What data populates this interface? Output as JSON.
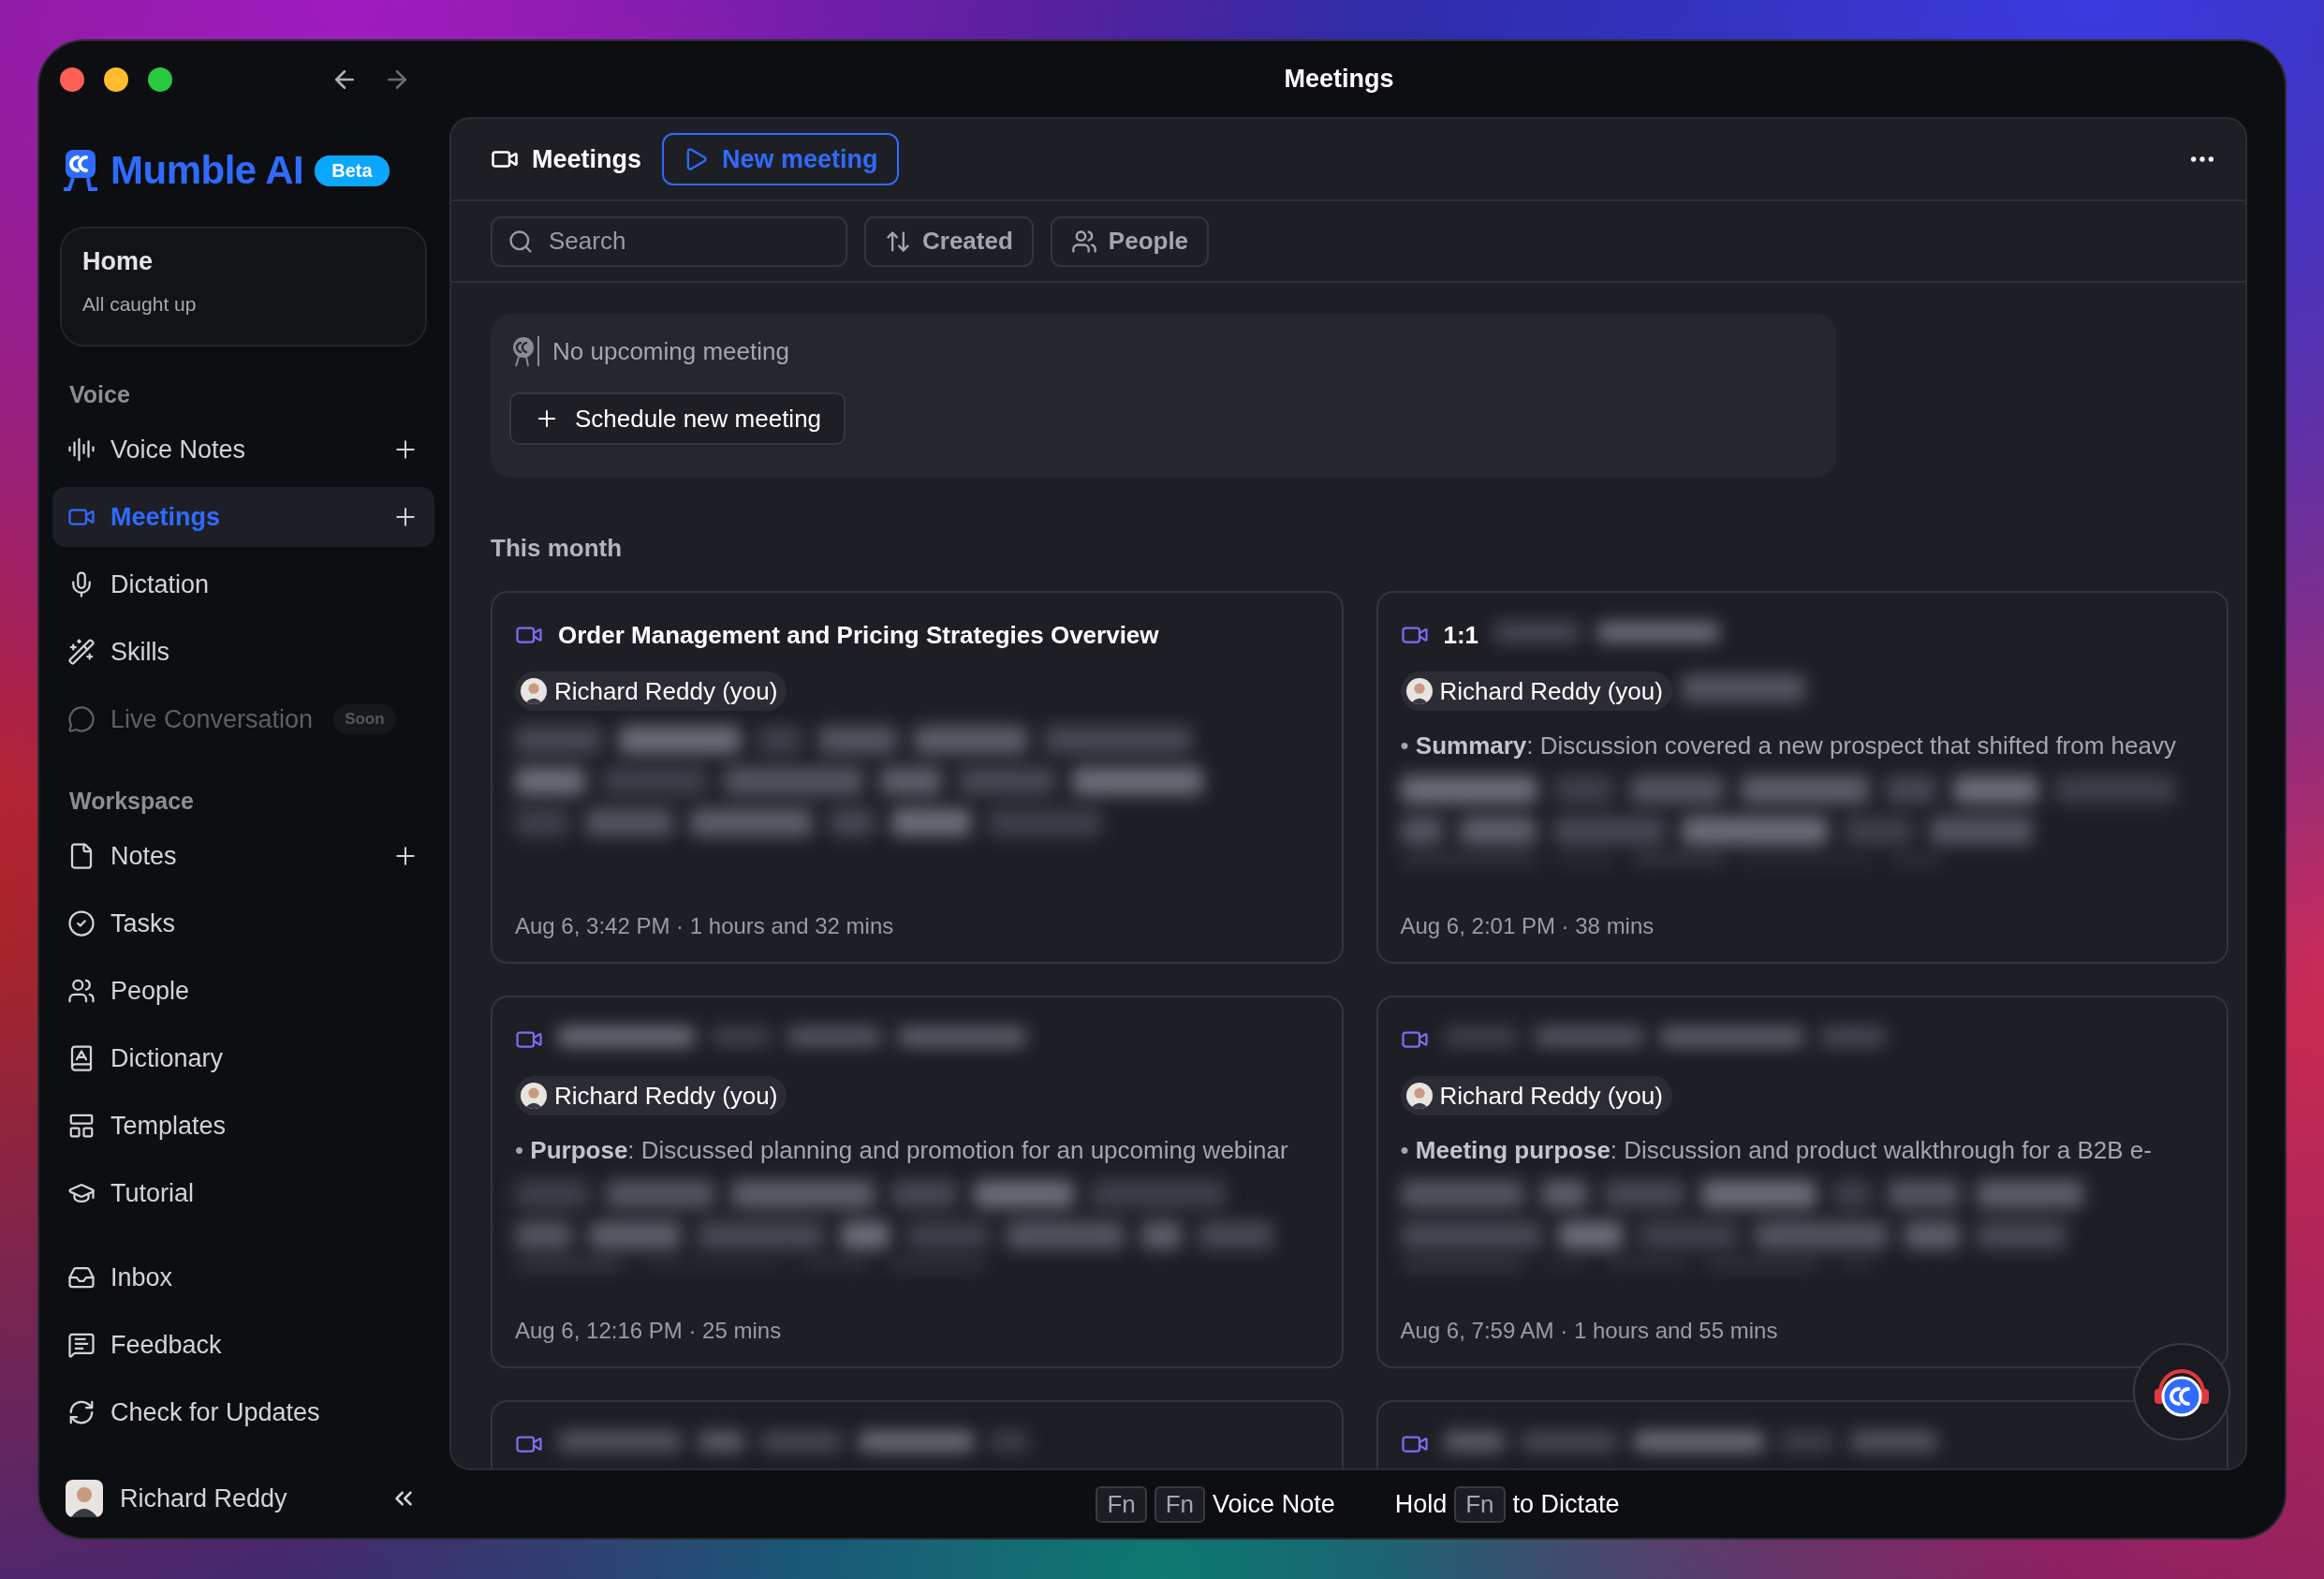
{
  "window": {
    "title": "Meetings"
  },
  "brand": {
    "name": "Mumble AI",
    "badge": "Beta"
  },
  "home_card": {
    "title": "Home",
    "subtitle": "All caught up"
  },
  "sidebar": {
    "sections": [
      {
        "heading": "Voice",
        "items": [
          {
            "label": "Voice Notes",
            "selected": false,
            "disabled": false,
            "add": true
          },
          {
            "label": "Meetings",
            "selected": true,
            "disabled": false,
            "add": true
          },
          {
            "label": "Dictation",
            "selected": false,
            "disabled": false,
            "add": false
          },
          {
            "label": "Skills",
            "selected": false,
            "disabled": false,
            "add": false
          },
          {
            "label": "Live Conversation",
            "selected": false,
            "disabled": true,
            "add": false,
            "badge": "Soon"
          }
        ]
      },
      {
        "heading": "Workspace",
        "items": [
          {
            "label": "Notes",
            "selected": false,
            "disabled": false,
            "add": true
          },
          {
            "label": "Tasks",
            "selected": false,
            "disabled": false,
            "add": false
          },
          {
            "label": "People",
            "selected": false,
            "disabled": false,
            "add": false
          },
          {
            "label": "Dictionary",
            "selected": false,
            "disabled": false,
            "add": false
          },
          {
            "label": "Templates",
            "selected": false,
            "disabled": false,
            "add": false
          },
          {
            "label": "Tutorial",
            "selected": false,
            "disabled": false,
            "add": false
          }
        ]
      },
      {
        "items": [
          {
            "label": "Inbox",
            "selected": false,
            "disabled": false,
            "add": false
          },
          {
            "label": "Feedback",
            "selected": false,
            "disabled": false,
            "add": false
          },
          {
            "label": "Check for Updates",
            "selected": false,
            "disabled": false,
            "add": false
          }
        ]
      }
    ]
  },
  "user": {
    "name": "Richard Reddy"
  },
  "header": {
    "title": "Meetings",
    "new_button": "New meeting"
  },
  "filters": {
    "search_placeholder": "Search",
    "sort": "Created",
    "people": "People"
  },
  "upcoming": {
    "message": "No upcoming meeting",
    "button": "Schedule new meeting"
  },
  "section_heading": "This month",
  "meetings": [
    {
      "title": "Order Management and Pricing Strategies Overview",
      "attendee": "Richard Reddy (you)",
      "body_redacted": true,
      "meta": "Aug 6, 3:42 PM · 1 hours and 32 mins"
    },
    {
      "title": "1:1",
      "title_redacted": true,
      "attendee": "Richard Reddy (you)",
      "guest_redacted": true,
      "summary": "• **Summary**: Discussion covered a new prospect that shifted from heavy",
      "body_redacted": true,
      "meta": "Aug 6, 2:01 PM · 38 mins"
    },
    {
      "title_redacted": true,
      "attendee": "Richard Reddy (you)",
      "summary": "• **Purpose**: Discussed planning and promotion for an upcoming webinar",
      "body_redacted": true,
      "meta": "Aug 6, 12:16 PM · 25 mins"
    },
    {
      "title_redacted": true,
      "attendee": "Richard Reddy (you)",
      "summary": "• **Meeting purpose**: Discussion and product walkthrough for a B2B e-",
      "body_redacted": true,
      "meta": "Aug 6, 7:59 AM · 1 hours and 55 mins"
    },
    {
      "title_redacted": true
    },
    {
      "title_redacted": true
    }
  ],
  "shortcuts": [
    {
      "keys": [
        "Fn",
        "Fn"
      ],
      "label": "Voice Note"
    },
    {
      "prefix": "Hold",
      "keys": [
        "Fn"
      ],
      "label": "to Dictate"
    }
  ]
}
